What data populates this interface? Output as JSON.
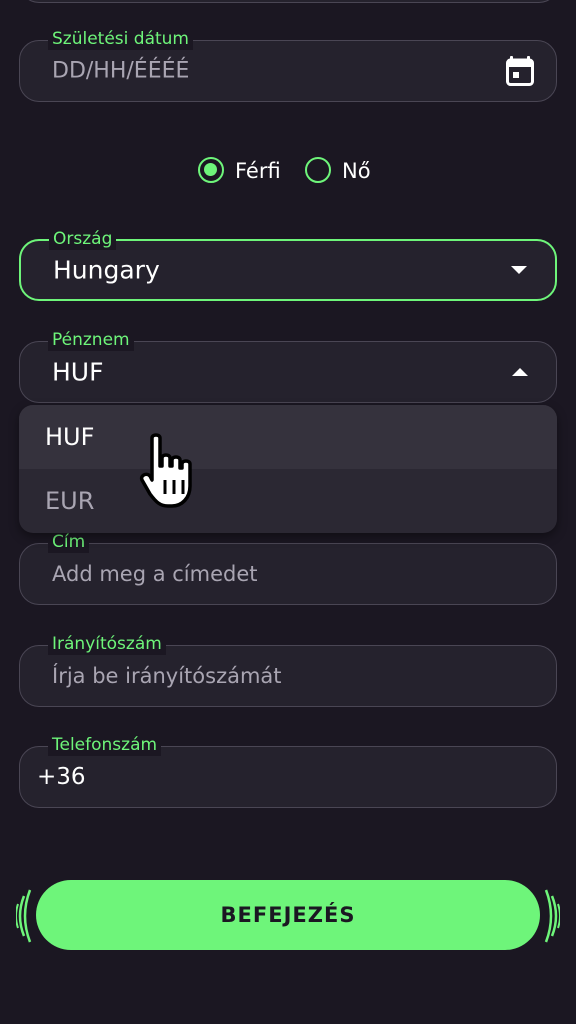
{
  "birth_date": {
    "label": "Születési dátum",
    "placeholder": "DD/HH/ÉÉÉÉ",
    "icon": "calendar-icon"
  },
  "gender": {
    "options": [
      {
        "label": "Férfi",
        "checked": true
      },
      {
        "label": "Nő",
        "checked": false
      }
    ]
  },
  "country": {
    "label": "Ország",
    "value": "Hungary"
  },
  "currency": {
    "label": "Pénznem",
    "value": "HUF",
    "options": [
      "HUF",
      "EUR"
    ]
  },
  "address": {
    "label": "Cím",
    "placeholder": "Add meg a címedet"
  },
  "postal_code": {
    "label": "Irányítószám",
    "placeholder": "Írja be irányítószámát"
  },
  "phone": {
    "label": "Telefonszám",
    "value": "+36"
  },
  "finish_button": {
    "label": "BEFEJEZÉS"
  },
  "colors": {
    "accent": "#6ef57a",
    "background": "#1b1722",
    "field_bg": "#25222d",
    "field_border": "#4a4654"
  }
}
